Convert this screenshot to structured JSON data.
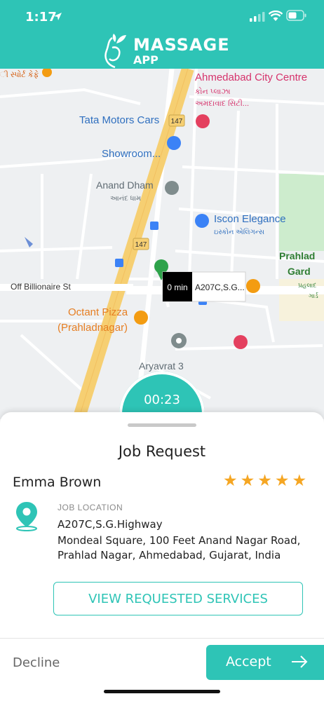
{
  "status_bar": {
    "time": "1:17"
  },
  "header": {
    "logo_line1": "MASSAGE",
    "logo_line2": "APP"
  },
  "map": {
    "labels": {
      "top_left_poi": "ી સ્પોર્ટ કેફે",
      "city_centre": "Ahmedabad City Centre",
      "city_centre_gu1": "કોન પ્લાઝા",
      "city_centre_gu2": "અમદાવાદ સિટી...",
      "route_147_a": "147",
      "route_147_b": "147",
      "tata_line1": "Tata Motors Cars",
      "tata_line2": "Showroom...",
      "anand_dham": "Anand Dham",
      "anand_dham_gu": "આનંદ ધામ",
      "iscon": "Iscon Elegance",
      "iscon_gu": "ઇસ્કોન એલિગન્સ",
      "prahlad_line1": "Prahlad",
      "prahlad_line2": "Gard",
      "prahlad_gu1": "પ્રહલાદ",
      "prahlad_gu2": "ગાર્ડ",
      "off_billionaire": "Off Billionaire St",
      "octant_line1": "Octant Pizza",
      "octant_line2": "(Prahladnagar)",
      "aryavrat": "Aryavrat 3",
      "eta": "0 min",
      "callout_address": "A207C,S.G..."
    }
  },
  "timer": {
    "text": "00:23"
  },
  "sheet": {
    "title": "Job Request",
    "client_name": "Emma Brown",
    "rating": 5,
    "location_label": "JOB LOCATION",
    "address_line1": "A207C,S.G.Highway",
    "address_line2": "Mondeal Square, 100 Feet Anand Nagar Road,",
    "address_line3": "Prahlad Nagar, Ahmedabad, Gujarat, India",
    "view_button": "VIEW REQUESTED SERVICES",
    "decline": "Decline",
    "accept": "Accept"
  },
  "colors": {
    "accent": "#2ec4b6",
    "star": "#f5a623",
    "road_major": "#f6cf72"
  },
  "icons": [
    "location-arrow-icon",
    "signal-icon",
    "wifi-icon",
    "battery-icon",
    "lotus-logo-icon",
    "map-pin-icon",
    "arrow-right-icon"
  ]
}
